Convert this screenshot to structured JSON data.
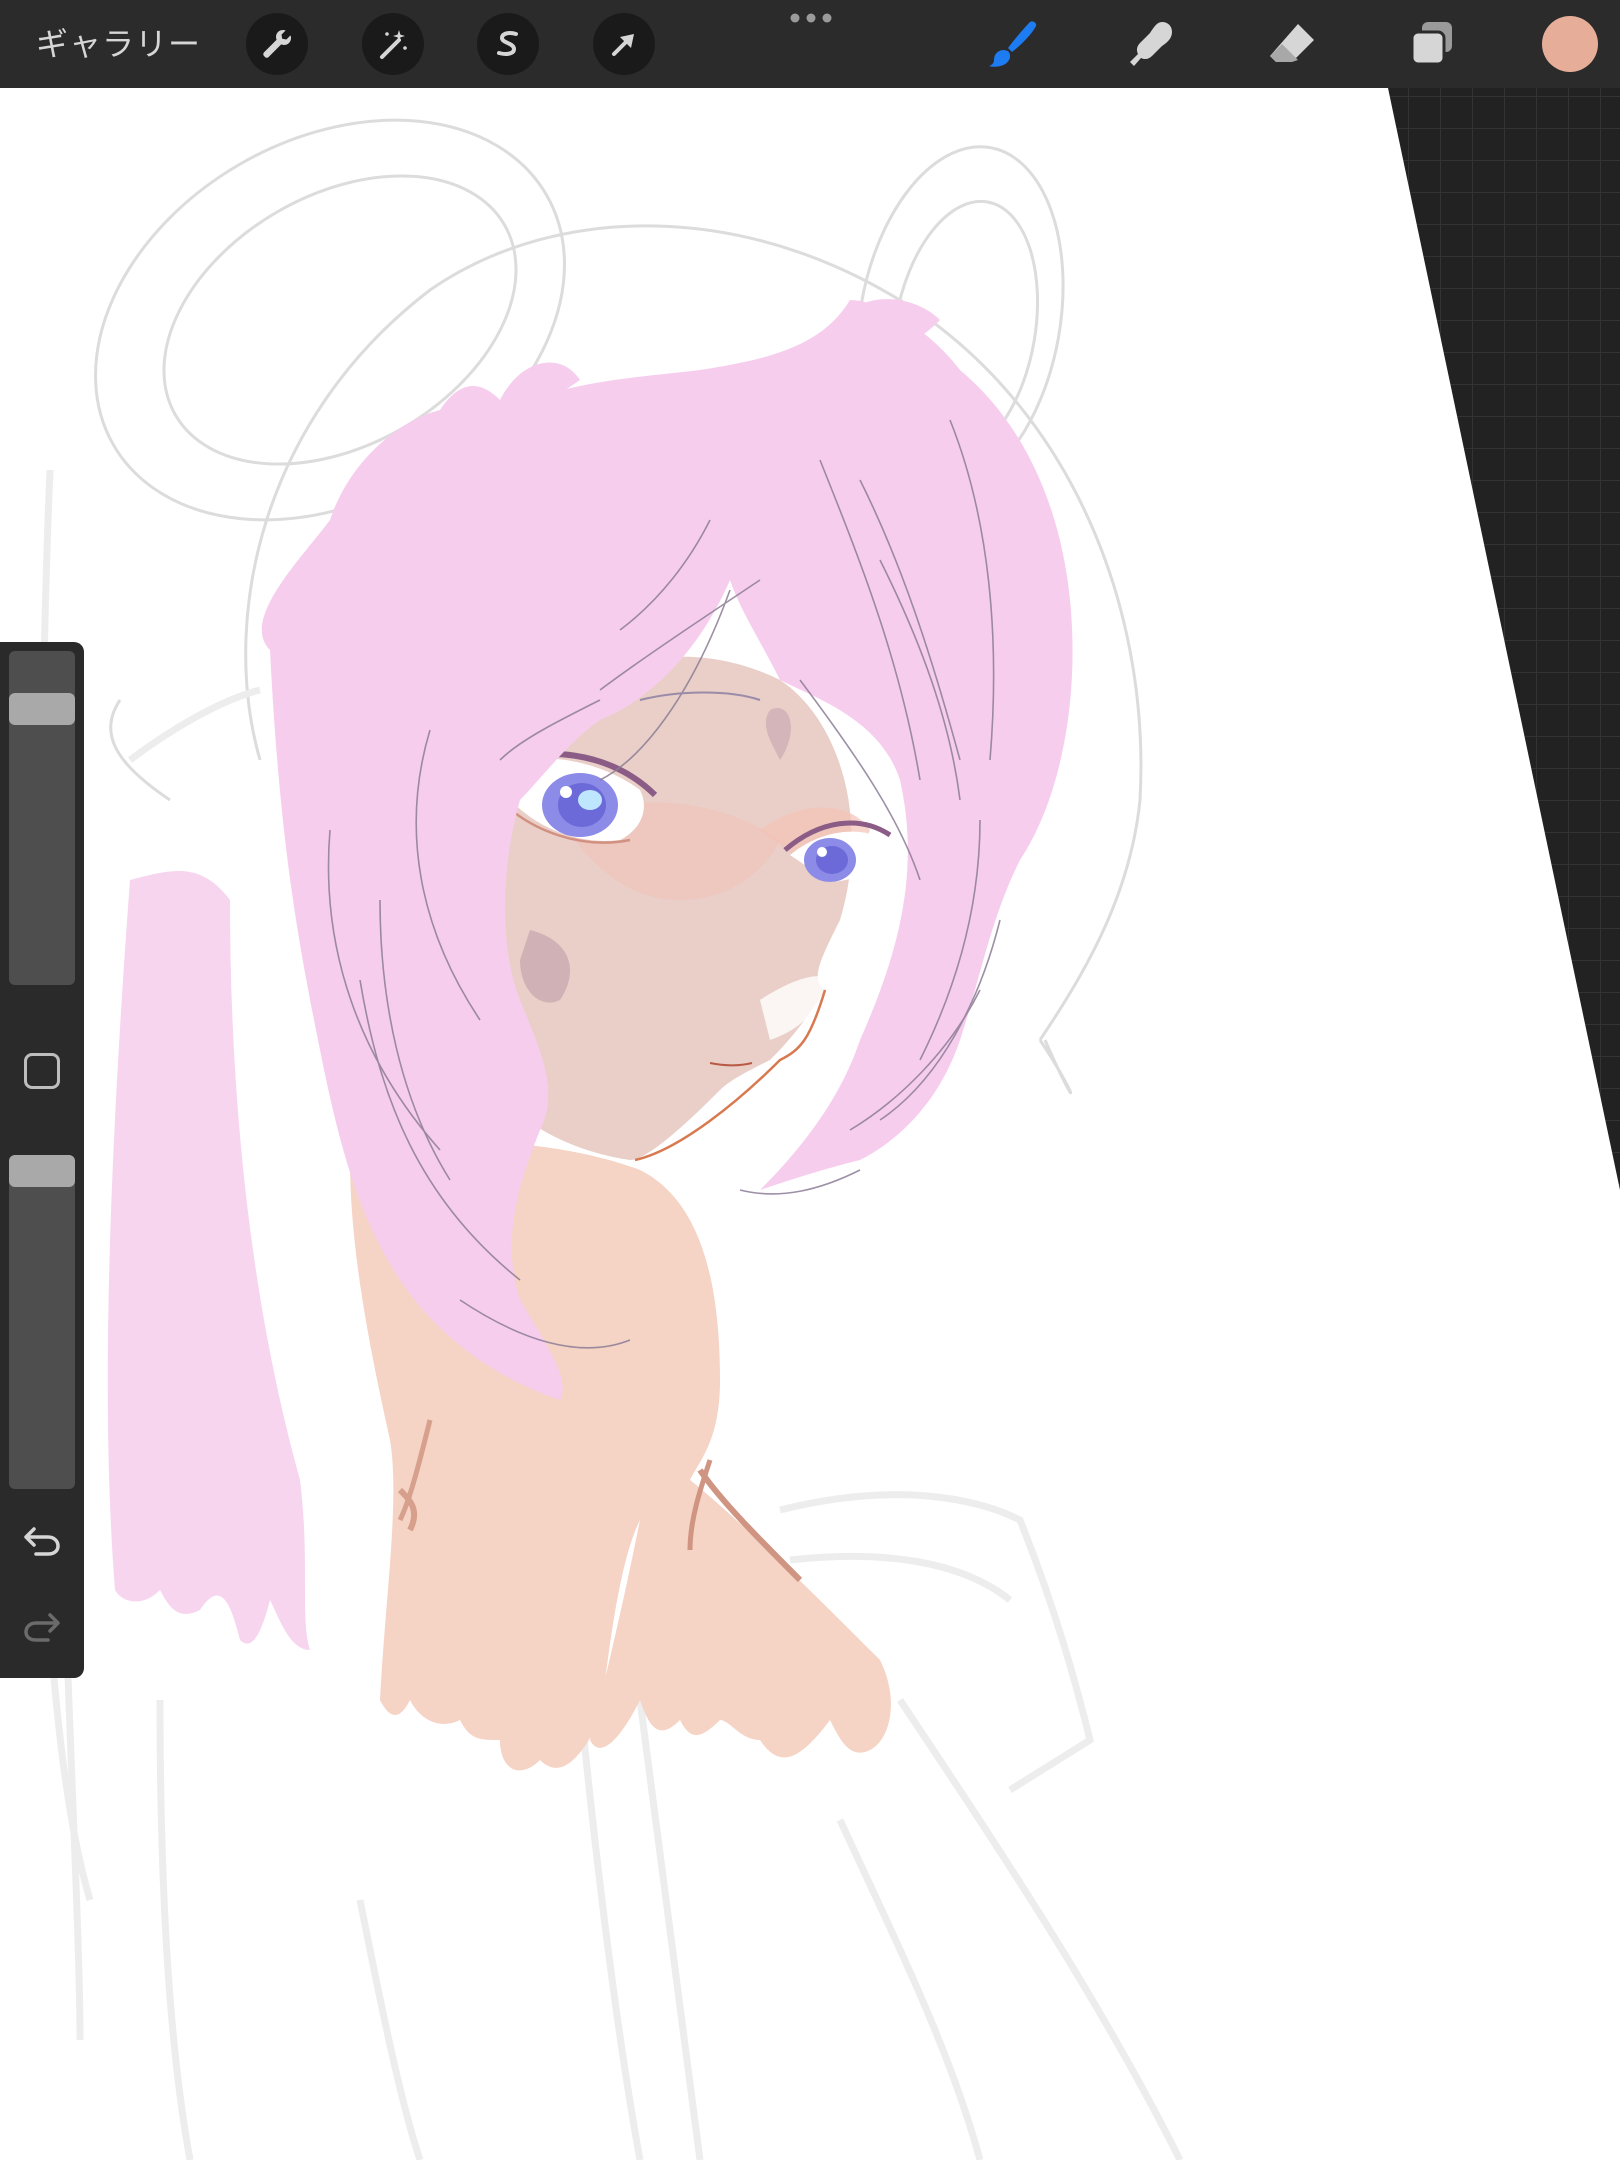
{
  "toolbar": {
    "gallery_label": "ギャラリー",
    "actions_icon": "wrench-icon",
    "adjustments_icon": "magic-wand-icon",
    "selection_icon": "selection-s-icon",
    "transform_icon": "arrow-cursor-icon",
    "more_icon": "ellipsis-icon",
    "brush_icon": "brush-icon",
    "smudge_icon": "smudge-finger-icon",
    "eraser_icon": "eraser-icon",
    "layers_icon": "layers-icon",
    "color": "#e6ae98",
    "active_tool_color": "#1e7cf2"
  },
  "sidebar": {
    "brush_size_level": 0.86,
    "opacity_level": 1.0,
    "modify_icon": "square-modify-icon",
    "undo_icon": "undo-icon",
    "redo_icon": "redo-icon"
  },
  "colors": {
    "hair": "#f7cdee",
    "skin": "#f5d3c5",
    "workspace": "#222222"
  }
}
